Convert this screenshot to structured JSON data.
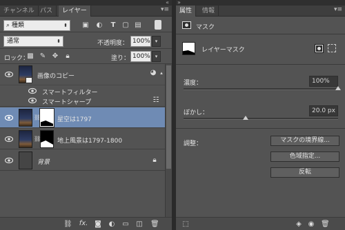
{
  "layers_panel": {
    "tabs": [
      "チャンネル",
      "パス",
      "レイヤー"
    ],
    "filter_kind": "種類",
    "blend_mode": "通常",
    "opacity_label": "不透明度：",
    "opacity_value": "100%",
    "lock_label": "ロック：",
    "fill_label": "塗り：",
    "fill_value": "100%",
    "layers": [
      {
        "name": "画像のコピー"
      },
      {
        "name": "スマートフィルター"
      },
      {
        "name": "スマートシャープ"
      },
      {
        "name": "星空は1797"
      },
      {
        "name": "地上風景は1797-1800"
      },
      {
        "name": "背景"
      }
    ]
  },
  "properties_panel": {
    "tabs": [
      "属性",
      "情報"
    ],
    "header": "マスク",
    "mask_type": "レイヤーマスク",
    "density_label": "濃度：",
    "density_value": "100%",
    "density_level": 1.0,
    "feather_label": "ぼかし：",
    "feather_value": "20.0 px",
    "feather_level": 0.4,
    "refine_label": "調整：",
    "buttons": [
      "マスクの境界線...",
      "色域指定...",
      "反転"
    ]
  },
  "colors": {
    "selected_row": "#6f8bb4",
    "panel": "#535353"
  }
}
